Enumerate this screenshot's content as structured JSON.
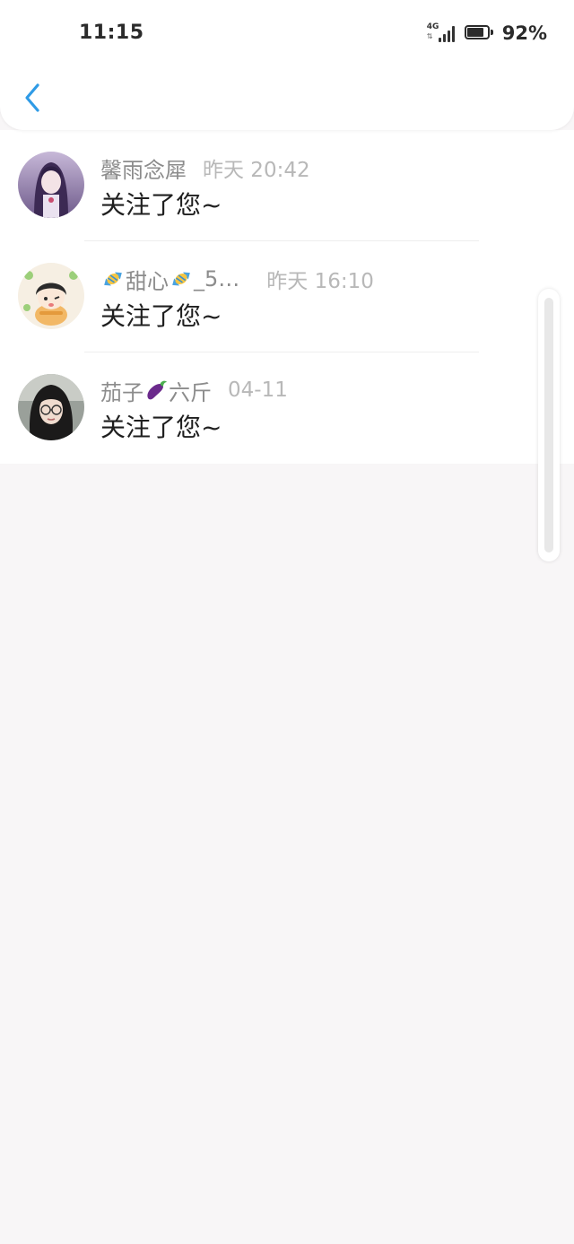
{
  "status_bar": {
    "time": "11:15",
    "network": "4G",
    "battery_percent": "92%",
    "battery_level": 0.92
  },
  "nav": {
    "back_icon": "chevron-left-icon",
    "accent_color": "#2f9be6"
  },
  "notifications": [
    {
      "username": "馨雨念犀",
      "time": "昨天 20:42",
      "message": "关注了您~"
    },
    {
      "username_prefix": "",
      "username_middle": " 甜心",
      "username_suffix": "_5…",
      "time": "昨天 16:10",
      "message": "关注了您~"
    },
    {
      "username_prefix": "茄子",
      "username_suffix": "六斤",
      "time": "04-11",
      "message": "关注了您~"
    }
  ],
  "colors": {
    "page_background": "#f8f6f7",
    "card_background": "#ffffff",
    "username": "#8c8c8c",
    "timestamp": "#b8b8b8",
    "message": "#1f1f1f"
  }
}
